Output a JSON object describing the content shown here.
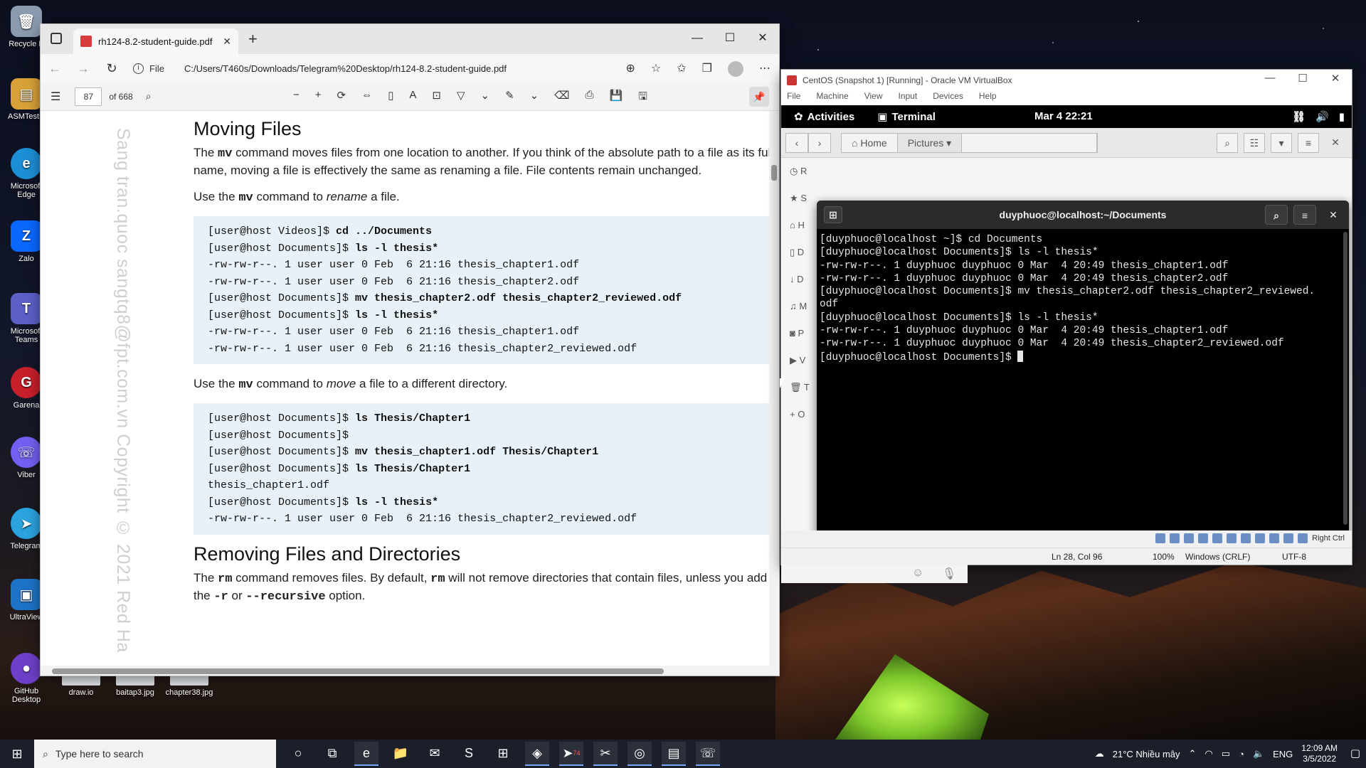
{
  "desktop": {
    "icons": [
      "Recycle B",
      "ASMTestN",
      "Microsoft Edge",
      "Zalo",
      "Microsoft Teams",
      "Garena",
      "Viber",
      "Telegram",
      "UltraView",
      "GitHub Desktop"
    ],
    "files": [
      "draw.io",
      "baitap3.jpg",
      "chapter38.jpg"
    ]
  },
  "edge": {
    "tab_title": "rh124-8.2-student-guide.pdf",
    "file_label": "File",
    "url": "C:/Users/T460s/Downloads/Telegram%20Desktop/rh124-8.2-student-guide.pdf",
    "page_number": "87",
    "page_count": "of 668",
    "watermark": "Sang tran.quoc sangtq8@fpt.com.vn   Copyright © 2021 Red Ha"
  },
  "pdf": {
    "h1": "Moving Files",
    "p1_a": "The ",
    "p1_cmd": "mv",
    "p1_b": " command moves files from one location to another. If you think of the absolute path to a file as its full name, moving a file is effectively the same as renaming a file. File contents remain unchanged.",
    "p2_a": "Use the ",
    "p2_cmd": "mv",
    "p2_b": " command to ",
    "p2_em": "rename",
    "p2_c": " a file.",
    "code1": [
      {
        "prompt": "[user@host Videos]$ ",
        "cmd": "cd ../Documents"
      },
      {
        "prompt": "[user@host Documents]$ ",
        "cmd": "ls -l thesis*"
      },
      {
        "prompt": "-rw-rw-r--. 1 user user 0 Feb  6 21:16 thesis_chapter1.odf",
        "cmd": ""
      },
      {
        "prompt": "-rw-rw-r--. 1 user user 0 Feb  6 21:16 thesis_chapter2.odf",
        "cmd": ""
      },
      {
        "prompt": "[user@host Documents]$ ",
        "cmd": "mv thesis_chapter2.odf thesis_chapter2_reviewed.odf"
      },
      {
        "prompt": "[user@host Documents]$ ",
        "cmd": "ls -l thesis*"
      },
      {
        "prompt": "-rw-rw-r--. 1 user user 0 Feb  6 21:16 thesis_chapter1.odf",
        "cmd": ""
      },
      {
        "prompt": "-rw-rw-r--. 1 user user 0 Feb  6 21:16 thesis_chapter2_reviewed.odf",
        "cmd": ""
      }
    ],
    "p3_a": "Use the ",
    "p3_cmd": "mv",
    "p3_b": " command to ",
    "p3_em": "move",
    "p3_c": " a file to a different directory.",
    "code2": [
      {
        "prompt": "[user@host Documents]$ ",
        "cmd": "ls Thesis/Chapter1"
      },
      {
        "prompt": "[user@host Documents]$",
        "cmd": ""
      },
      {
        "prompt": "[user@host Documents]$ ",
        "cmd": "mv thesis_chapter1.odf Thesis/Chapter1"
      },
      {
        "prompt": "[user@host Documents]$ ",
        "cmd": "ls Thesis/Chapter1"
      },
      {
        "prompt": "thesis_chapter1.odf",
        "cmd": ""
      },
      {
        "prompt": "[user@host Documents]$ ",
        "cmd": "ls -l thesis*"
      },
      {
        "prompt": "-rw-rw-r--. 1 user user 0 Feb  6 21:16 thesis_chapter2_reviewed.odf",
        "cmd": ""
      }
    ],
    "h2": "Removing Files and Directories",
    "p4_a": "The ",
    "p4_cmd1": "rm",
    "p4_b": " command removes files. By default, ",
    "p4_cmd2": "rm",
    "p4_c": " will not remove directories that contain files, unless you add the ",
    "p4_opt1": "-r",
    "p4_d": " or ",
    "p4_opt2": "--recursive",
    "p4_e": " option."
  },
  "vbox": {
    "title": "CentOS (Snapshot 1) [Running] - Oracle VM VirtualBox",
    "menu": [
      "File",
      "Machine",
      "View",
      "Input",
      "Devices",
      "Help"
    ],
    "host_key": "Right Ctrl"
  },
  "gnome": {
    "activities": "Activities",
    "app": "Terminal",
    "clock": "Mar 4  22:21"
  },
  "nautilus": {
    "path": [
      "Home",
      "Pictures"
    ],
    "sidebar_letters": [
      "R",
      "S",
      "H",
      "D",
      "D",
      "M",
      "P",
      "V",
      "T",
      "O"
    ]
  },
  "terminal": {
    "title": "duyphuoc@localhost:~/Documents",
    "lines": [
      "[duyphuoc@localhost ~]$ cd Documents",
      "[duyphuoc@localhost Documents]$ ls -l thesis*",
      "-rw-rw-r--. 1 duyphuoc duyphuoc 0 Mar  4 20:49 thesis_chapter1.odf",
      "-rw-rw-r--. 1 duyphuoc duyphuoc 0 Mar  4 20:49 thesis_chapter2.odf",
      "[duyphuoc@localhost Documents]$ mv thesis_chapter2.odf thesis_chapter2_reviewed.",
      "odf",
      "[duyphuoc@localhost Documents]$ ls -l thesis*",
      "-rw-rw-r--. 1 duyphuoc duyphuoc 0 Mar  4 20:49 thesis_chapter1.odf",
      "-rw-rw-r--. 1 duyphuoc duyphuoc 0 Mar  4 20:49 thesis_chapter2_reviewed.odf"
    ],
    "prompt": "[duyphuoc@localhost Documents]$ "
  },
  "notepad_status": {
    "position": "Ln 28, Col 96",
    "zoom": "100%",
    "eol": "Windows (CRLF)",
    "encoding": "UTF-8"
  },
  "taskbar": {
    "search_placeholder": "Type here to search",
    "weather": "21°C  Nhiều mây",
    "lang": "ENG",
    "time": "12:09 AM",
    "date": "3/5/2022",
    "telegram_badge": "74"
  }
}
